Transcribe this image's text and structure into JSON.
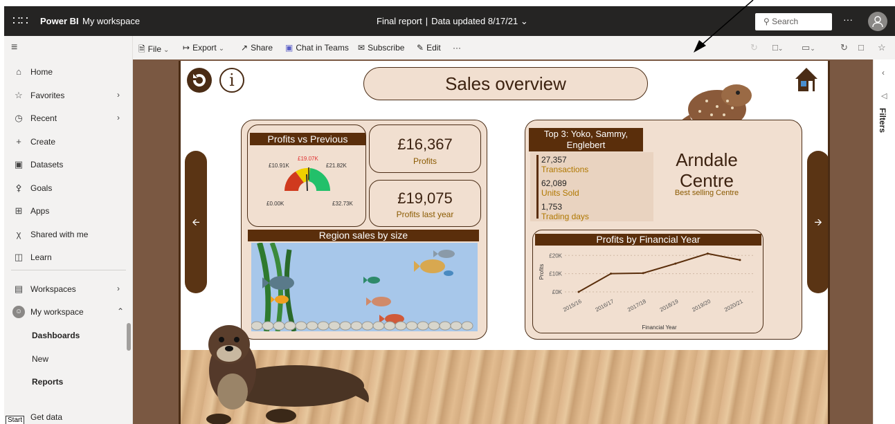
{
  "topbar": {
    "brand": "Power BI",
    "workspace": "My workspace",
    "report_title": "Final report",
    "data_updated": "Data updated 8/17/21",
    "search_placeholder": "Search",
    "more": "···"
  },
  "nav": {
    "items": [
      {
        "label": "Home",
        "icon": "home-icon"
      },
      {
        "label": "Favorites",
        "icon": "star-icon"
      },
      {
        "label": "Recent",
        "icon": "clock-icon"
      },
      {
        "label": "Create",
        "icon": "plus-icon"
      },
      {
        "label": "Datasets",
        "icon": "cylinder-icon"
      },
      {
        "label": "Goals",
        "icon": "trophy-icon"
      },
      {
        "label": "Apps",
        "icon": "apps-icon"
      },
      {
        "label": "Shared with me",
        "icon": "shared-icon"
      },
      {
        "label": "Learn",
        "icon": "book-icon"
      },
      {
        "label": "Workspaces",
        "icon": "workspaces-icon"
      },
      {
        "label": "My workspace",
        "icon": "avatar-icon"
      }
    ],
    "sub_items": [
      "Dashboards",
      "New",
      "Reports",
      "Get data"
    ],
    "start_badge": "Start"
  },
  "commands": {
    "file": "File",
    "export": "Export",
    "share": "Share",
    "chat": "Chat in Teams",
    "subscribe": "Subscribe",
    "edit": "Edit",
    "more": "···"
  },
  "right_rail": {
    "filters": "Filters"
  },
  "report": {
    "title": "Sales overview",
    "gauge": {
      "header": "Profits vs Previous",
      "labels": {
        "min": "£0.00K",
        "left": "£10.91K",
        "target": "£19.07K",
        "right": "£21.82K",
        "max": "£32.73K"
      }
    },
    "profits": {
      "value": "£16,367",
      "label": "Profits"
    },
    "profits_last_year": {
      "value": "£19,075",
      "label": "Profits last year"
    },
    "region_header": "Region sales by size",
    "top3": {
      "header_line1": "Top 3: Yoko, Sammy,",
      "header_line2": "Englebert",
      "stats": [
        {
          "value": "27,357",
          "label": "Transactions"
        },
        {
          "value": "62,089",
          "label": "Units Sold"
        },
        {
          "value": "1,753",
          "label": "Trading days"
        }
      ]
    },
    "centre": {
      "line1": "Arndale",
      "line2": "Centre",
      "subtitle": "Best selling Centre"
    },
    "line_chart_header": "Profits by Financial Year"
  },
  "chart_data": {
    "type": "line",
    "title": "Profits by Financial Year",
    "xlabel": "Financial Year",
    "ylabel": "Profits",
    "categories": [
      "2015/16",
      "2016/17",
      "2017/18",
      "2018/19",
      "2019/20",
      "2020/21"
    ],
    "values": [
      0,
      10000,
      10300,
      15500,
      21000,
      17500
    ],
    "yticks": [
      "£0K",
      "£10K",
      "£20K"
    ],
    "ylim": [
      0,
      22000
    ],
    "color": "#5a2e0b"
  }
}
